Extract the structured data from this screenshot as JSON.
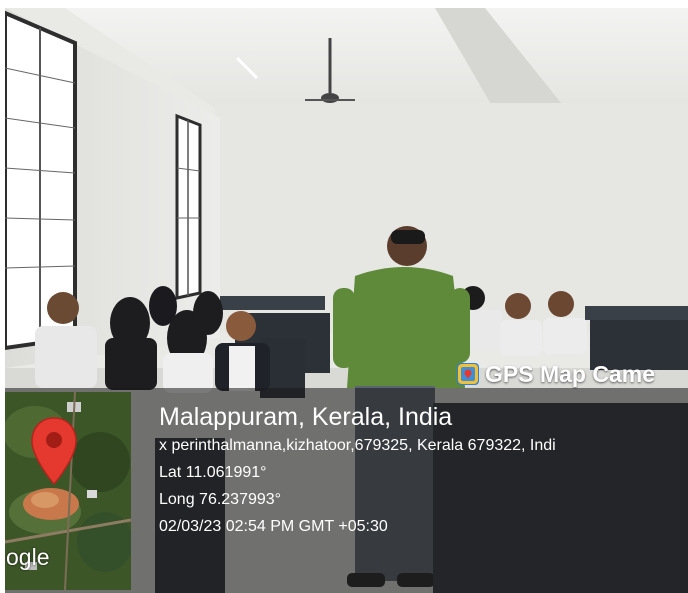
{
  "stamp": {
    "app_name": "GPS Map Came",
    "app_icon": "gps-map-camera-icon",
    "place": "Malappuram, Kerala, India",
    "address": "x perinthalmanna,kizhatoor,679325, Kerala 679322, Indi",
    "latitude": "Lat 11.061991°",
    "longitude": "Long 76.237993°",
    "datetime": "02/03/23 02:54 PM GMT +05:30",
    "map_attribution": "ogle",
    "pin_color": "#e5392f"
  }
}
